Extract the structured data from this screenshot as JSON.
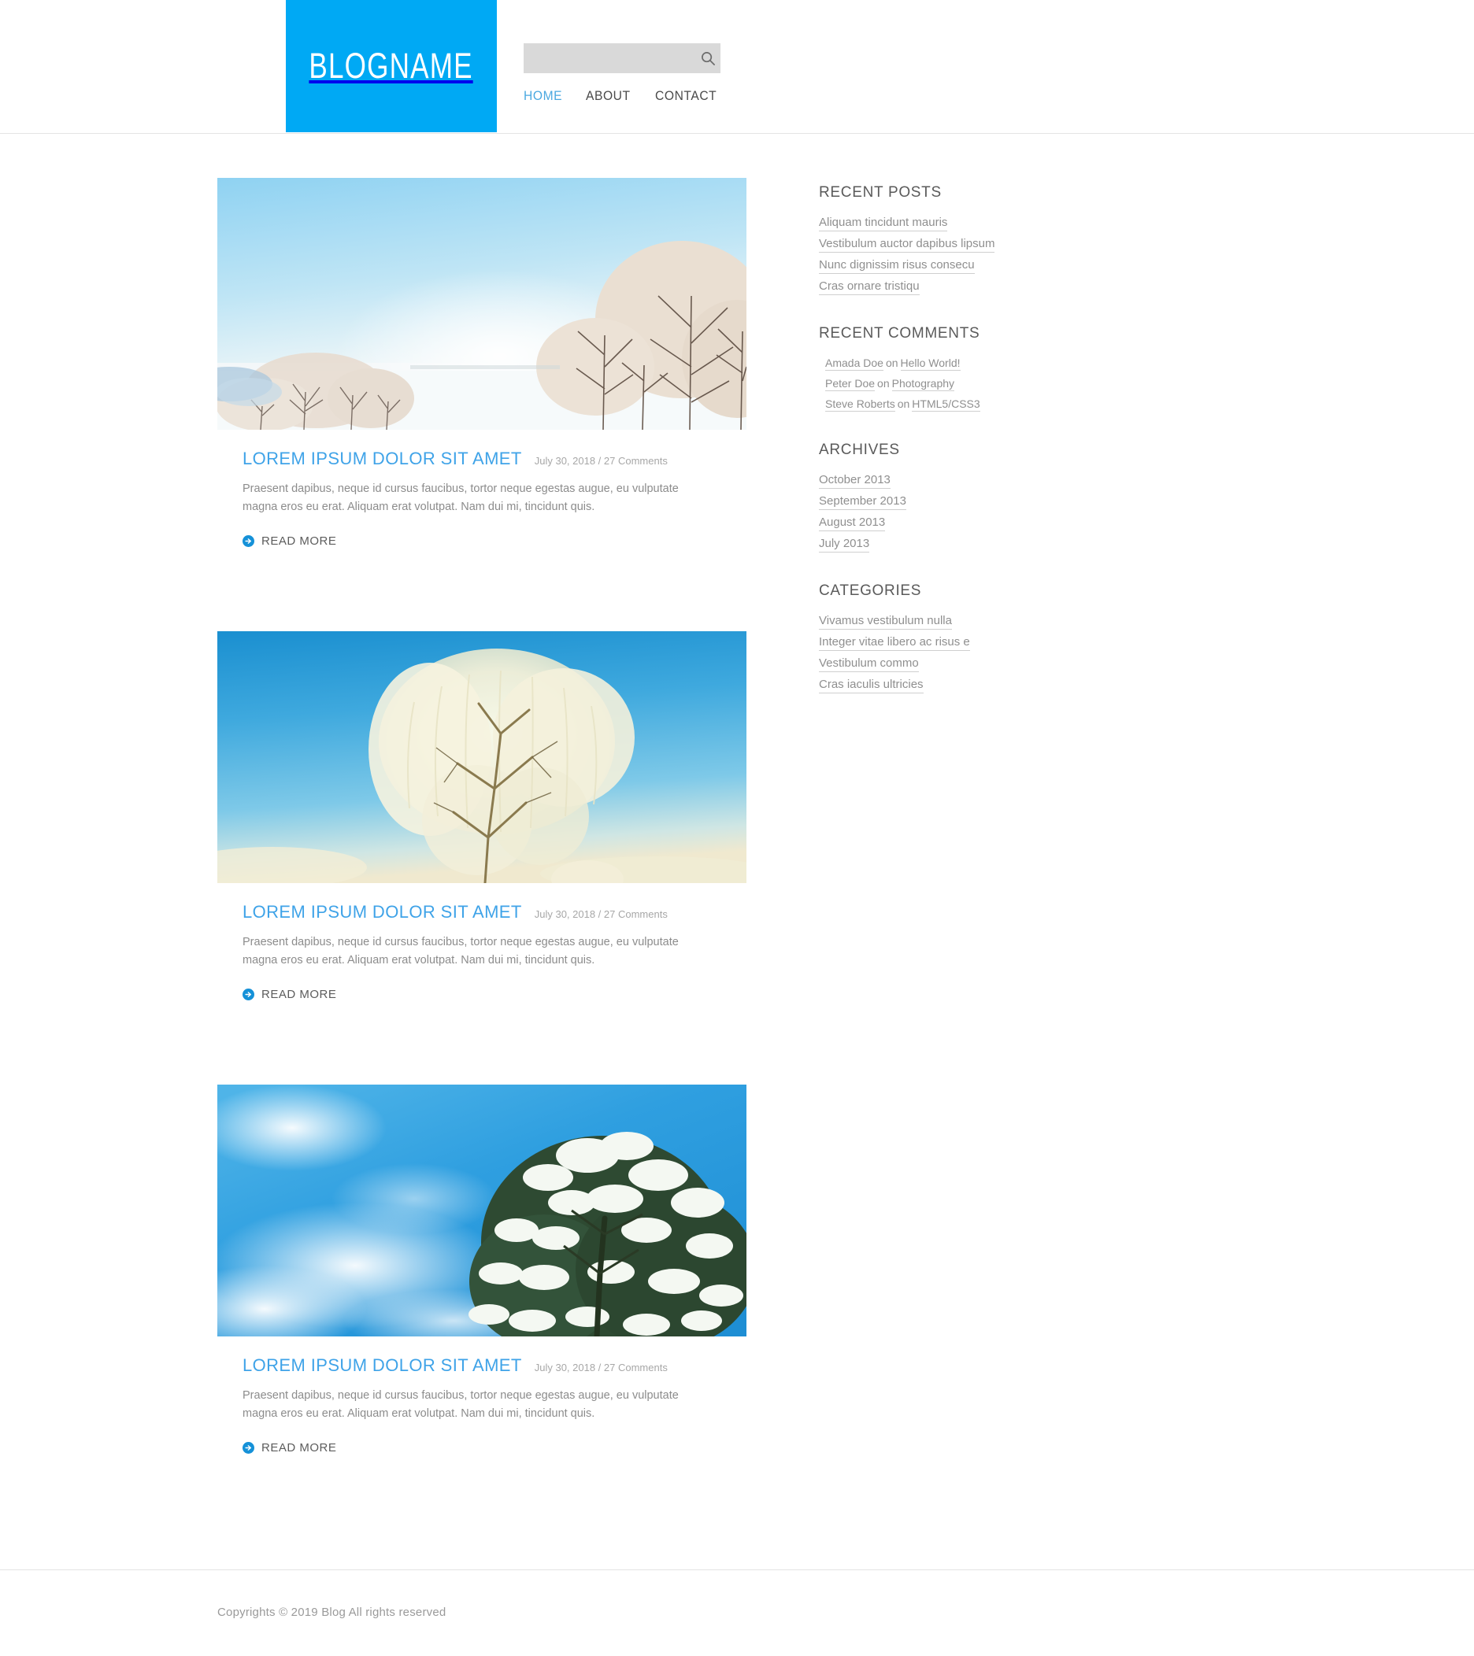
{
  "header": {
    "logo_text": "BLOGNAME",
    "logo_bg_color": "#00a9f4",
    "search": {
      "value": "",
      "placeholder": "",
      "icon": "search-icon"
    },
    "nav": [
      {
        "label": "HOME",
        "active": true
      },
      {
        "label": "ABOUT",
        "active": false
      },
      {
        "label": "CONTACT",
        "active": false
      }
    ],
    "nav_active_color": "#4aa8e0"
  },
  "posts": [
    {
      "image_alt": "winter-landscape-frosted-trees-snow-field",
      "title": "LOREM IPSUM DOLOR SIT AMET",
      "meta": "July 30, 2018 / 27 Comments",
      "excerpt": "Praesent dapibus, neque id cursus faucibus, tortor neque egestas augue, eu vulputate magna eros eu erat. Aliquam erat volutpat. Nam dui mi, tincidunt quis.",
      "read_more": "READ MORE"
    },
    {
      "image_alt": "frosted-willow-tree-against-blue-sky",
      "title": "LOREM IPSUM DOLOR SIT AMET",
      "meta": "July 30, 2018 / 27 Comments",
      "excerpt": "Praesent dapibus, neque id cursus faucibus, tortor neque egestas augue, eu vulputate magna eros eu erat. Aliquam erat volutpat. Nam dui mi, tincidunt quis.",
      "read_more": "READ MORE"
    },
    {
      "image_alt": "snow-covered-tree-blue-sky-clouds",
      "title": "LOREM IPSUM DOLOR SIT AMET",
      "meta": "July 30, 2018 / 27 Comments",
      "excerpt": "Praesent dapibus, neque id cursus faucibus, tortor neque egestas augue, eu vulputate magna eros eu erat. Aliquam erat volutpat. Nam dui mi, tincidunt quis.",
      "read_more": "READ MORE"
    }
  ],
  "sidebar": {
    "recent_posts": {
      "title": "RECENT POSTS",
      "items": [
        "Aliquam tincidunt mauris",
        "Vestibulum auctor dapibus lipsum",
        "Nunc dignissim risus consecu",
        "Cras ornare tristiqu"
      ]
    },
    "recent_comments": {
      "title": "RECENT COMMENTS",
      "on_word": "on",
      "items": [
        {
          "author": "Amada Doe",
          "post": "Hello World!"
        },
        {
          "author": "Peter Doe",
          "post": "Photography"
        },
        {
          "author": "Steve Roberts",
          "post": "HTML5/CSS3"
        }
      ]
    },
    "archives": {
      "title": "ARCHIVES",
      "items": [
        "October 2013",
        "September 2013",
        "August 2013",
        "July 2013"
      ]
    },
    "categories": {
      "title": "CATEGORIES",
      "items": [
        "Vivamus vestibulum nulla",
        "Integer vitae libero ac risus e",
        "Vestibulum commo",
        "Cras iaculis ultricies"
      ]
    }
  },
  "footer": {
    "copyright": "Copyrights © 2019 Blog All rights reserved"
  },
  "colors": {
    "accent": "#00a9f4",
    "title_link": "#3fa3e8",
    "body_text": "#8c8c8c"
  }
}
